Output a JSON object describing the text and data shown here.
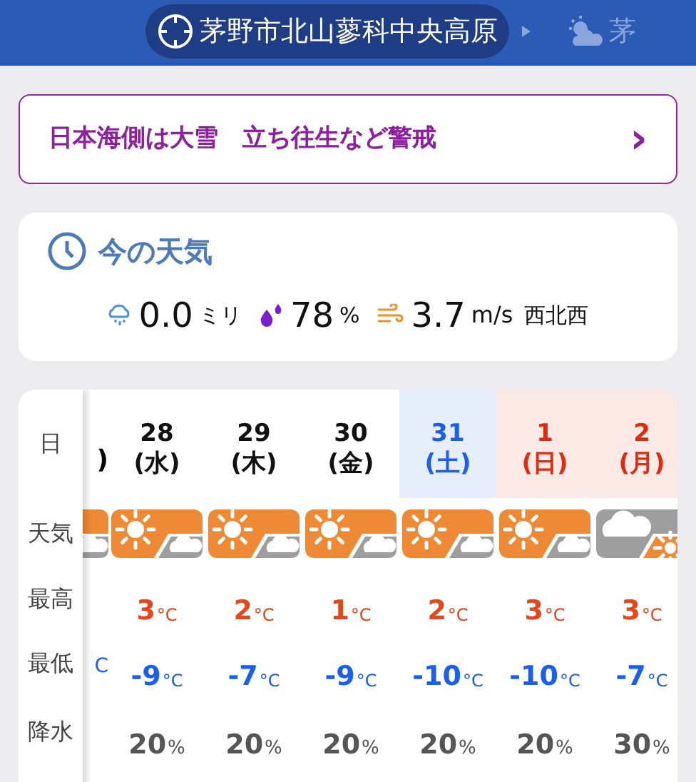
{
  "header": {
    "location": "茅野市北山蓼科中央高原",
    "next_location": "茅"
  },
  "alert": {
    "text": "日本海側は大雪　立ち往生など警戒",
    "arrow": "›"
  },
  "current": {
    "title": "今の天気",
    "precip": "0.0",
    "precip_unit": "ミリ",
    "humidity": "78",
    "humidity_unit": "%",
    "wind": "3.7",
    "wind_unit": "m/s",
    "wind_dir": "西北西"
  },
  "forecast": {
    "row_labels": [
      "日",
      "天気",
      "最高",
      "最低",
      "降水"
    ],
    "partial": {
      "date": ")",
      "weather": {
        "kind": "sunny_then_cloudy"
      },
      "low": "C"
    },
    "days": [
      {
        "day": "28",
        "weekday": "(水)",
        "kind": "weekday",
        "weather": {
          "kind": "sunny_then_cloudy"
        },
        "high": "3",
        "high_unit": "°C",
        "low": "-9",
        "low_unit": "°C",
        "precip": "20",
        "pct": "%"
      },
      {
        "day": "29",
        "weekday": "(木)",
        "kind": "weekday",
        "weather": {
          "kind": "sunny_then_cloudy"
        },
        "high": "2",
        "high_unit": "°C",
        "low": "-7",
        "low_unit": "°C",
        "precip": "20",
        "pct": "%"
      },
      {
        "day": "30",
        "weekday": "(金)",
        "kind": "weekday",
        "weather": {
          "kind": "sunny_then_cloudy"
        },
        "high": "1",
        "high_unit": "°C",
        "low": "-9",
        "low_unit": "°C",
        "precip": "20",
        "pct": "%"
      },
      {
        "day": "31",
        "weekday": "(土)",
        "kind": "saturday",
        "weather": {
          "kind": "sunny_then_cloudy"
        },
        "high": "2",
        "high_unit": "°C",
        "low": "-10",
        "low_unit": "°C",
        "precip": "20",
        "pct": "%"
      },
      {
        "day": "1",
        "weekday": "(日)",
        "kind": "holiday",
        "weather": {
          "kind": "sunny_then_cloudy"
        },
        "high": "3",
        "high_unit": "°C",
        "low": "-10",
        "low_unit": "°C",
        "precip": "20",
        "pct": "%"
      },
      {
        "day": "2",
        "weekday": "(月)",
        "kind": "holiday",
        "weather": {
          "kind": "cloudy_then_sunny"
        },
        "high": "3",
        "high_unit": "°C",
        "low": "-7",
        "low_unit": "°C",
        "precip": "30",
        "pct": "%"
      }
    ]
  }
}
